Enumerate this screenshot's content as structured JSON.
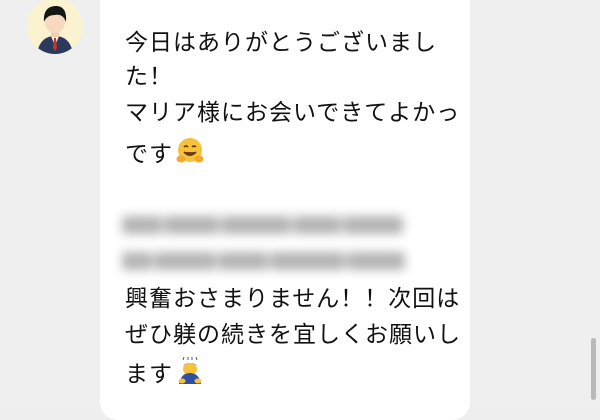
{
  "message": {
    "lines": [
      "今日はありがとうございまし",
      "た！",
      "マリア様にお会いできてよかっ",
      "です",
      "興奮おさまりません！！次回は",
      "ぜひ躾の続きを宜しくお願いし",
      "ます"
    ],
    "emoji_1": "hugging-face-emoji",
    "emoji_2": "person-bowing-emoji"
  },
  "colors": {
    "background": "#efefef",
    "bubble": "#ffffff",
    "avatar_bg": "#fbf2cf",
    "text": "#111111"
  }
}
